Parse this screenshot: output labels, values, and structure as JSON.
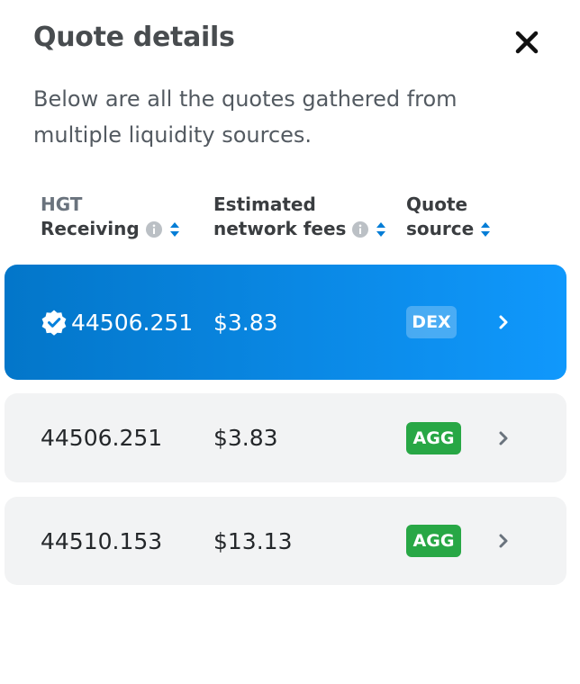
{
  "modal": {
    "title": "Quote details",
    "description": "Below are all the quotes gathered from multiple liquidity sources."
  },
  "columns": {
    "receiving_token": "HGT",
    "receiving_label": "Receiving",
    "fees_line1": "Estimated",
    "fees_line2": "network fees",
    "source_line1": "Quote",
    "source_line2": "source"
  },
  "quotes": [
    {
      "amount": "44506.251",
      "fee": "$3.83",
      "source": "DEX",
      "best": true
    },
    {
      "amount": "44506.251",
      "fee": "$3.83",
      "source": "AGG",
      "best": false
    },
    {
      "amount": "44510.153",
      "fee": "$13.13",
      "source": "AGG",
      "best": false
    }
  ],
  "icons": {
    "close": "close-icon",
    "info": "info-icon",
    "sort": "sort-arrows-icon",
    "best": "verified-badge-icon",
    "chevron": "chevron-right-icon"
  },
  "colors": {
    "best_row_start": "#0376c9",
    "best_row_end": "#1098fc",
    "agg_badge": "#28a745",
    "sort_arrow": "#037dd6",
    "row_background": "#f2f3f4"
  }
}
